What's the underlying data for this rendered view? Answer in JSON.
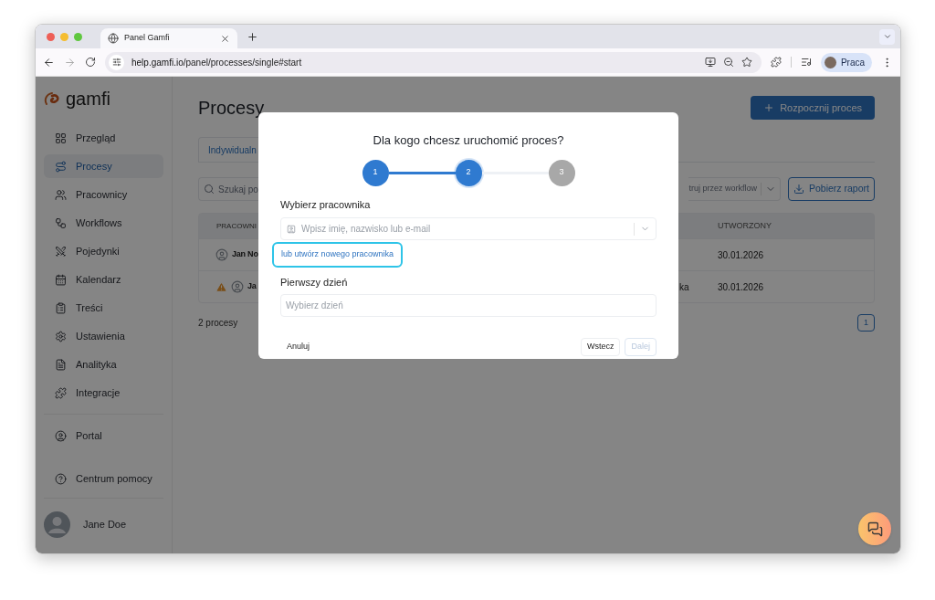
{
  "browser": {
    "tab_title": "Panel Gamfi",
    "url_host": "help.gamfi.io",
    "url_path": "/panel/processes/single#start",
    "profile": "Praca"
  },
  "sidebar": {
    "logo": "gamfi",
    "items": [
      {
        "label": "Przegląd",
        "selected": false
      },
      {
        "label": "Procesy",
        "selected": true
      },
      {
        "label": "Pracownicy",
        "selected": false
      },
      {
        "label": "Workflows",
        "selected": false
      },
      {
        "label": "Pojedynki",
        "selected": false
      },
      {
        "label": "Kalendarz",
        "selected": false
      },
      {
        "label": "Treści",
        "selected": false
      },
      {
        "label": "Ustawienia",
        "selected": false
      },
      {
        "label": "Analityka",
        "selected": false
      },
      {
        "label": "Integracje",
        "selected": false
      }
    ],
    "portal_item": {
      "label": "Portal",
      "selected": false
    },
    "help_item": "Centrum pomocy",
    "user": "Jane Doe"
  },
  "page": {
    "title": "Procesy",
    "start_button": "Rozpocznij proces",
    "tabs": [
      {
        "label": "Indywidualn",
        "selected": true
      }
    ],
    "search": {
      "placeholder": "Szukaj po"
    },
    "filter": {
      "placeholder": "truj przez workflow"
    },
    "report_button": "Pobierz raport",
    "table": {
      "columns": [
        "PRACOWNI",
        "UTWORZONY"
      ],
      "rows": [
        {
          "warning": false,
          "employee": "Jan No",
          "created": "30.01.2026"
        },
        {
          "warning": true,
          "employee": "Ja",
          "column_3": "ka",
          "created": "30.01.2026"
        }
      ]
    },
    "count": "2 procesy",
    "pagination": [
      {
        "label": "1",
        "selected": true
      }
    ]
  },
  "modal": {
    "title": "Dla kogo chcesz uruchomić proces?",
    "steps": [
      {
        "label": "1",
        "completed": true,
        "selected": false
      },
      {
        "label": "2",
        "completed": false,
        "selected": true
      },
      {
        "label": "3",
        "completed": false,
        "selected": false
      }
    ],
    "employee_label": "Wybierz pracownika",
    "employee_field": {
      "placeholder": "Wpisz imię, nazwisko lub e-mail"
    },
    "create_link": {
      "label": "lub utwórz nowego pracownika",
      "focused": true
    },
    "first_day_label": "Pierwszy dzień",
    "first_day_field": {
      "placeholder": "Wybierz dzień"
    },
    "cancel_button": "Anuluj",
    "back_button": "Wstecz",
    "next_button": {
      "label": "Dalej",
      "disabled": true
    }
  }
}
